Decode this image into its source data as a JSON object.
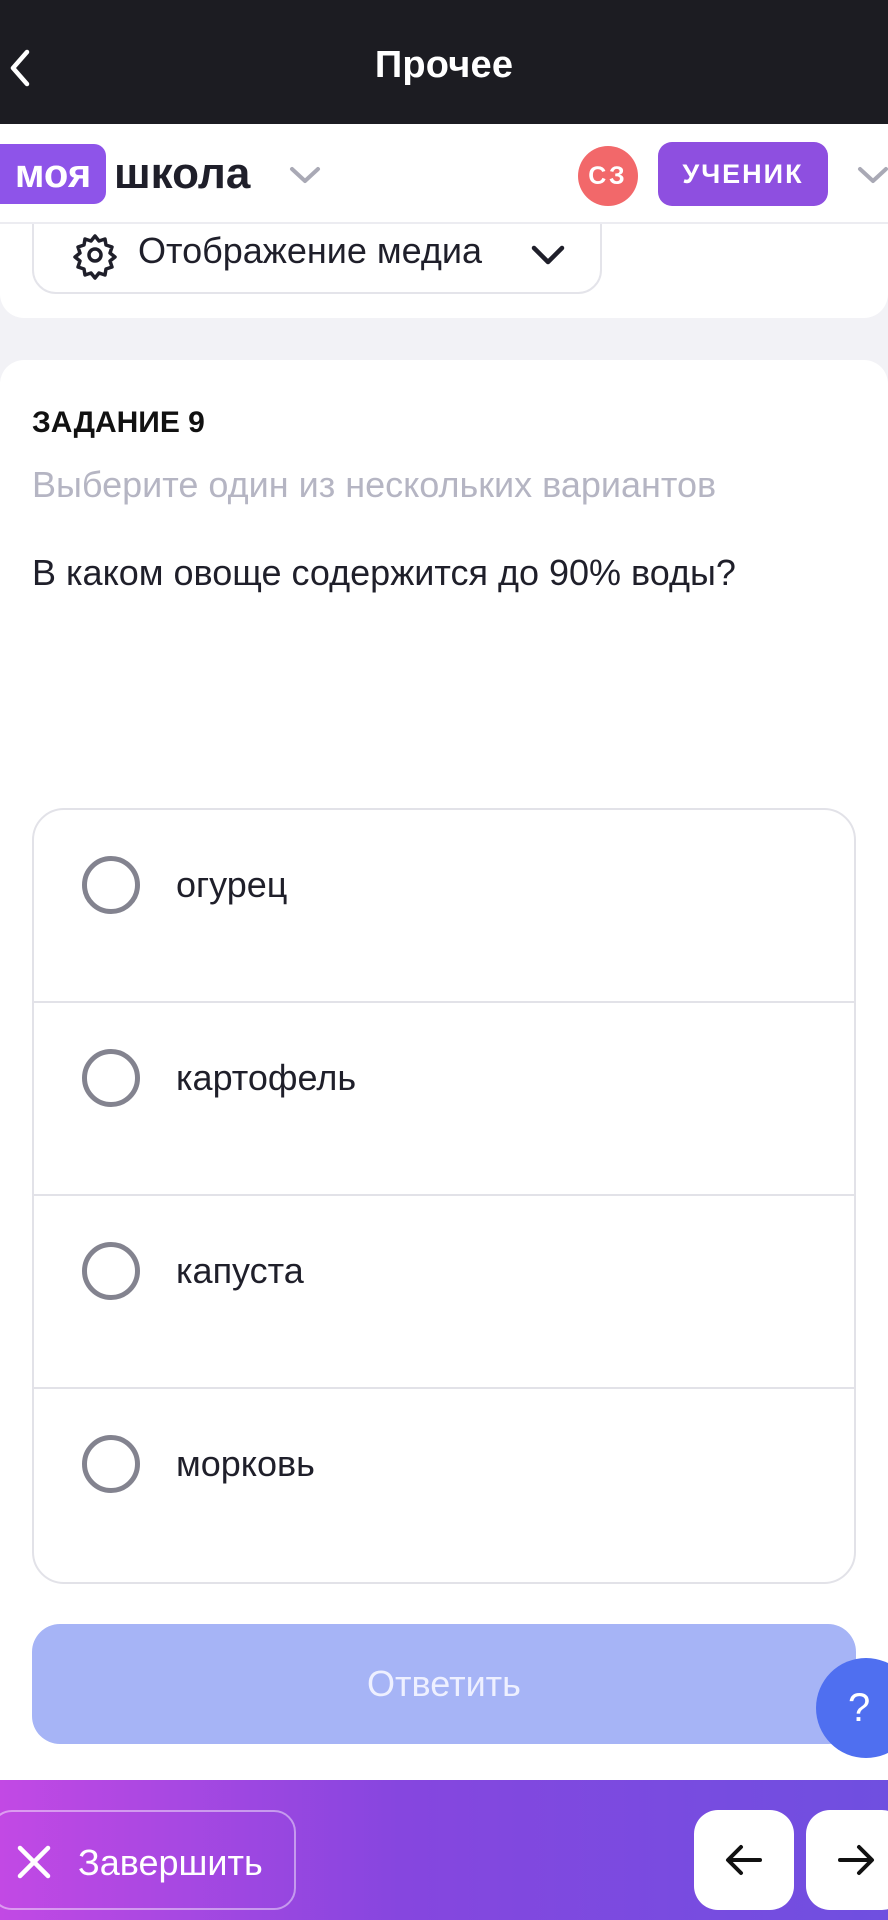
{
  "topbar": {
    "title": "Прочее"
  },
  "header": {
    "brand_part1": "моя",
    "brand_part2": "школа",
    "avatar_initials": "СЗ",
    "role": "УЧЕНИК"
  },
  "media": {
    "label": "Отображение медиа"
  },
  "task": {
    "title": "ЗАДАНИЕ 9",
    "hint": "Выберите один из нескольких вариантов",
    "question": "В каком овоще содержится до 90% воды?",
    "options": [
      {
        "label": "огурец"
      },
      {
        "label": "картофель"
      },
      {
        "label": "капуста"
      },
      {
        "label": "морковь"
      }
    ],
    "answer_label": "Ответить"
  },
  "help": {
    "label": "?"
  },
  "bottombar": {
    "finish_label": "Завершить"
  },
  "colors": {
    "brand": "#8e54e9",
    "avatar": "#f2686a",
    "answer_disabled": "#a6b4f6",
    "help": "#4f6ff0"
  }
}
